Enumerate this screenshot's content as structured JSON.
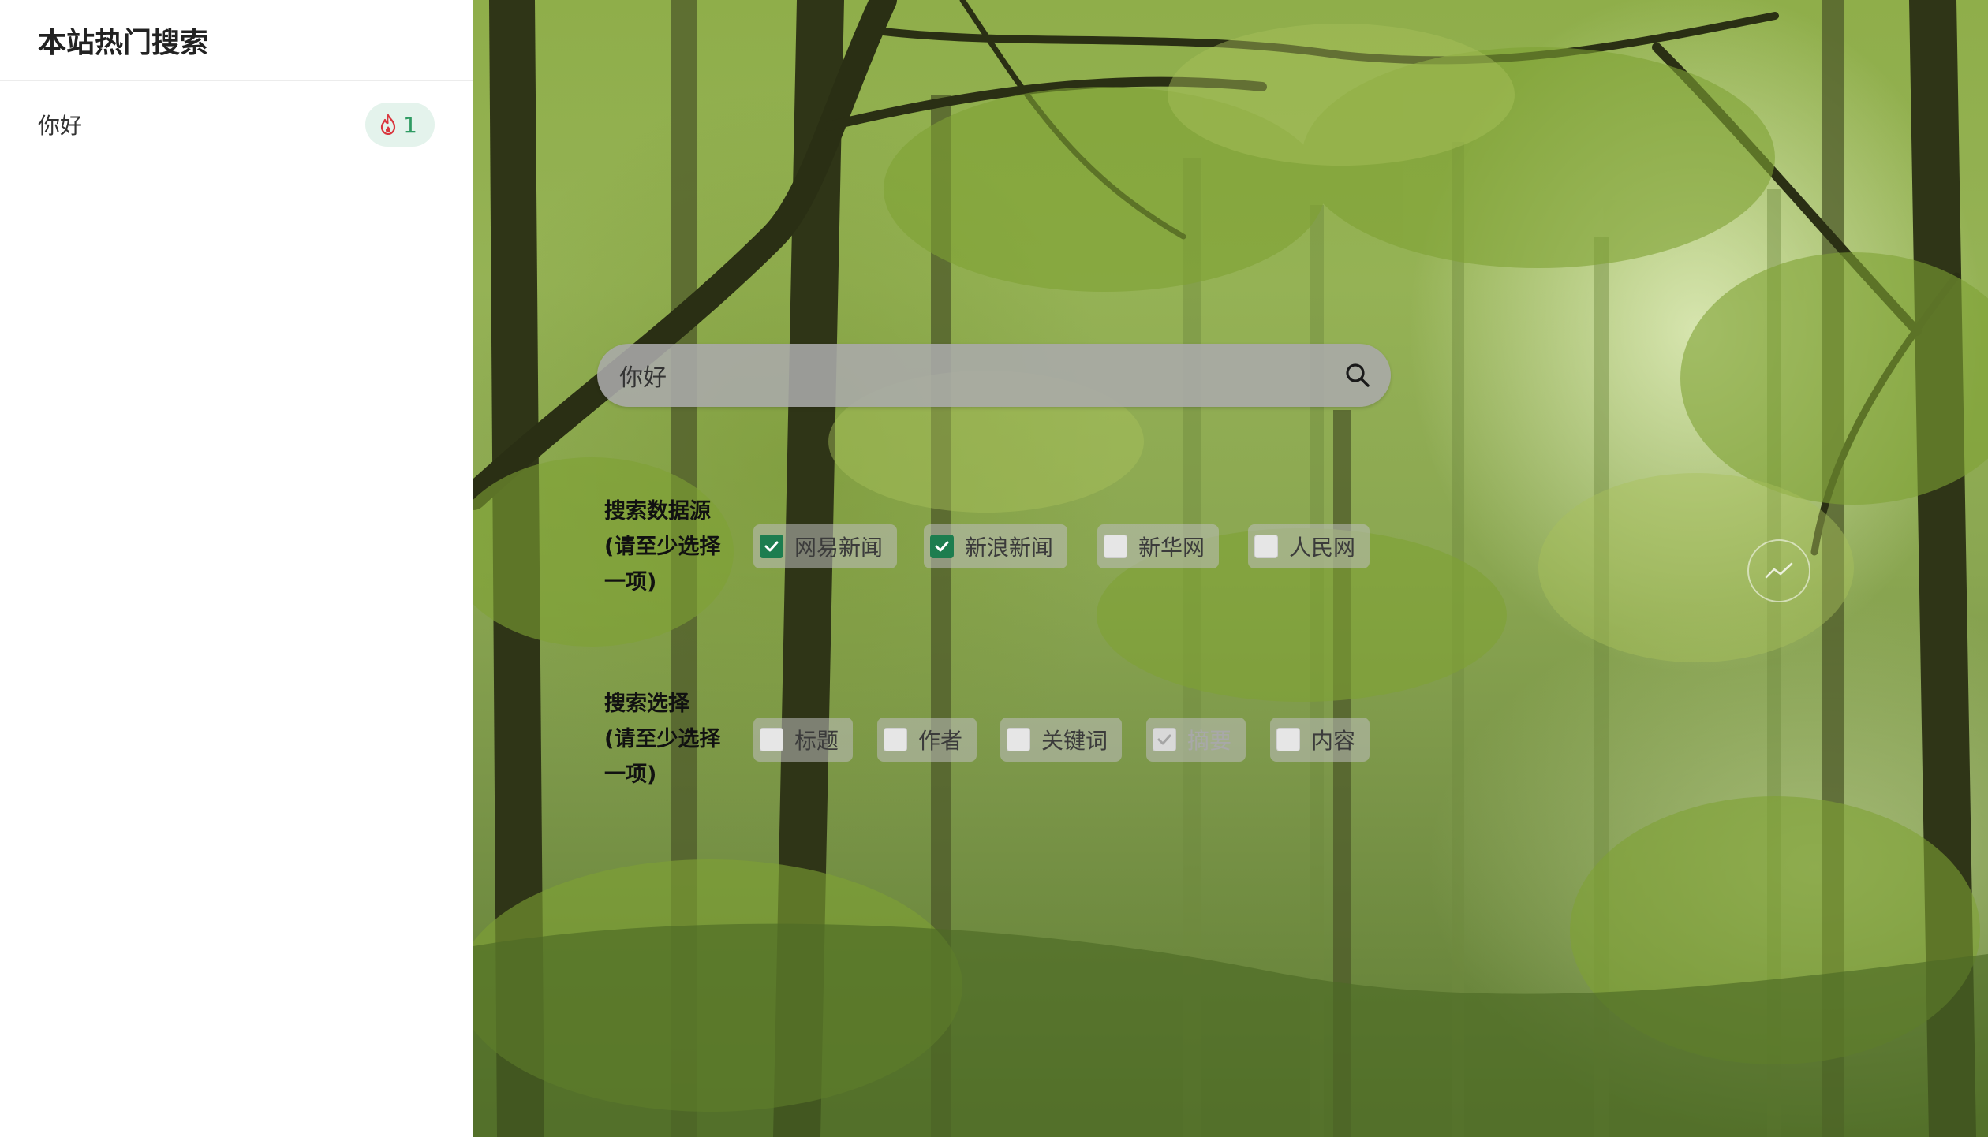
{
  "sidebar": {
    "title": "本站热门搜索",
    "hot_items": [
      {
        "label": "你好",
        "count": "1",
        "icon": "fire-icon"
      }
    ]
  },
  "search": {
    "value": "你好",
    "placeholder": "",
    "icon": "search-icon"
  },
  "source_group": {
    "label_lines": [
      "搜索数据源",
      "(请至少选择",
      "一项)"
    ],
    "options": [
      {
        "label": "网易新闻",
        "checked": true
      },
      {
        "label": "新浪新闻",
        "checked": true
      },
      {
        "label": "新华网",
        "checked": false
      },
      {
        "label": "人民网",
        "checked": false
      }
    ]
  },
  "field_group": {
    "label_lines": [
      "搜索选择",
      "(请至少选择",
      "一项)"
    ],
    "options": [
      {
        "label": "标题",
        "checked": false
      },
      {
        "label": "作者",
        "checked": false
      },
      {
        "label": "关键词",
        "checked": false
      },
      {
        "label": "摘要",
        "checked": true,
        "disabled": true
      },
      {
        "label": "内容",
        "checked": false
      }
    ]
  },
  "trend_button": {
    "icon": "trend-line-icon"
  },
  "colors": {
    "accent": "#1d7d4f",
    "badge_bg": "#e4f3ec",
    "badge_text": "#2f9b63",
    "fire": "#d9363e"
  }
}
